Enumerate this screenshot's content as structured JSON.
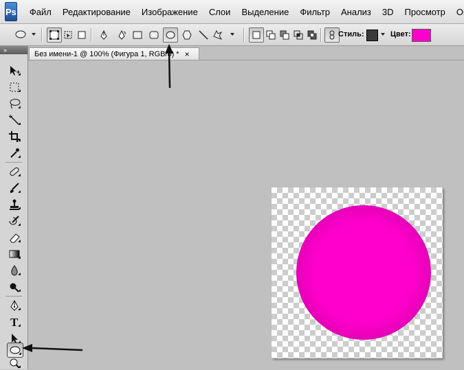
{
  "app": {
    "logo": "Ps"
  },
  "menu": [
    "Файл",
    "Редактирование",
    "Изображение",
    "Слои",
    "Выделение",
    "Фильтр",
    "Анализ",
    "3D",
    "Просмотр",
    "Окно"
  ],
  "options_bar": {
    "style_label": "Стиль:",
    "color_label": "Цвет:",
    "color_value": "#ff00cc",
    "style_value": "#3a3a3a"
  },
  "document": {
    "tab_title": "Без имени-1 @ 100% (Фигура 1, RGB/8) *",
    "close_glyph": "×"
  },
  "toolbox": {
    "collapse_glyph": "»",
    "tools": [
      "move-tool",
      "marquee-tool",
      "lasso-tool",
      "magic-wand-tool",
      "crop-tool",
      "eyedropper-tool",
      "healing-brush-tool",
      "brush-tool",
      "clone-stamp-tool",
      "history-brush-tool",
      "eraser-tool",
      "gradient-tool",
      "blur-tool",
      "dodge-tool",
      "pen-tool",
      "type-tool",
      "path-selection-tool",
      "ellipse-tool",
      "zoom-tool"
    ],
    "active_tool": "ellipse-tool"
  },
  "colors": {
    "shape_fill": "#ff00cc",
    "ps_blue": "#1c4f94"
  }
}
